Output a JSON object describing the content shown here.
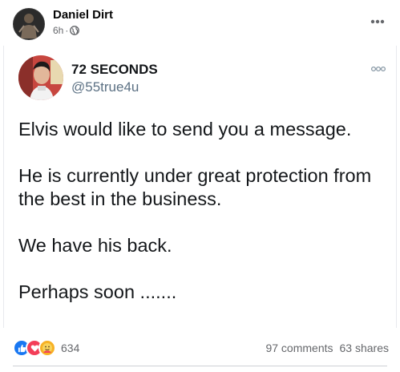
{
  "post": {
    "author_name": "Daniel Dirt",
    "timestamp": "6h",
    "separator": "·",
    "privacy_icon": "globe-icon",
    "more_icon": "ellipsis-icon"
  },
  "tweet": {
    "display_name": "72 SECONDS",
    "handle": "@55true4u",
    "more_icon": "ellipsis-icon",
    "paragraphs": [
      "Elvis would like to send you a message.",
      "He is currently under great protection from the best in the business.",
      "We have his back.",
      "Perhaps soon ......."
    ]
  },
  "footer": {
    "reaction_icons": [
      "like-icon",
      "love-icon",
      "care-icon"
    ],
    "reaction_count": "634",
    "comments": "97 comments",
    "shares": "63 shares"
  },
  "colors": {
    "like": "#1877f2",
    "love": "#f33e58",
    "care": "#f7b125",
    "secondary_text": "#65676b"
  }
}
